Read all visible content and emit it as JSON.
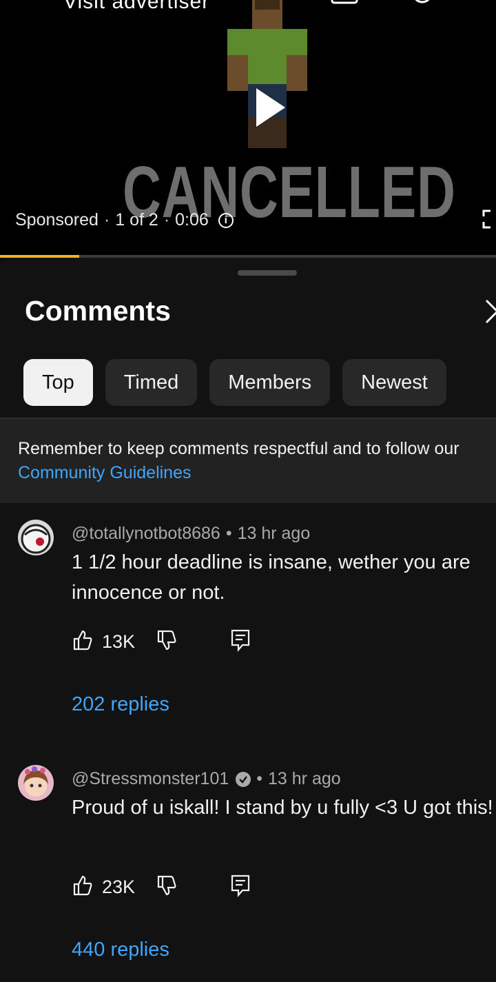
{
  "video": {
    "top_label": "Visit advertiser",
    "overlay_text": "CANCELLED",
    "sponsored": "Sponsored",
    "ad_position": "1 of 2",
    "time": "0:06",
    "separator": "·",
    "progress_percent": 16,
    "progress_color": "#f2b31c"
  },
  "comments_panel": {
    "title": "Comments",
    "tabs": [
      {
        "label": "Top",
        "active": true
      },
      {
        "label": "Timed",
        "active": false
      },
      {
        "label": "Members",
        "active": false
      },
      {
        "label": "Newest",
        "active": false
      }
    ],
    "notice_text": "Remember to keep comments respectful and to follow our",
    "notice_link": "Community Guidelines"
  },
  "comments": [
    {
      "author": "@totallynotbot8686",
      "time": "13 hr ago",
      "text": "1 1/2 hour deadline is insane, wether you are innocence or not.",
      "likes": "13K",
      "replies": "202 replies",
      "verified": false
    },
    {
      "author": "@Stressmonster101",
      "time": "13 hr ago",
      "text": "Proud of u iskall! I stand by u fully <3 U got this!",
      "likes": "23K",
      "replies": "440 replies",
      "verified": true
    }
  ],
  "colors": {
    "link": "#3ea6ff",
    "background": "#0f0f0f"
  }
}
